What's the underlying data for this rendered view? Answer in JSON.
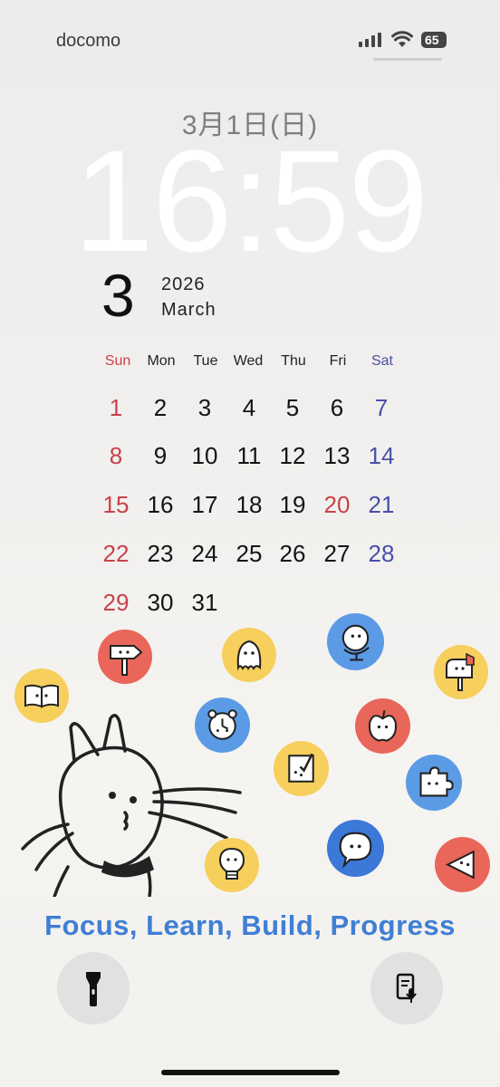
{
  "status_bar": {
    "carrier": "docomo",
    "battery": "65"
  },
  "lockscreen": {
    "date": "3月1日(日)",
    "time": "16:59"
  },
  "calendar": {
    "month_number": "3",
    "year": "2026",
    "month_name": "March",
    "weekdays": [
      "Sun",
      "Mon",
      "Tue",
      "Wed",
      "Thu",
      "Fri",
      "Sat"
    ],
    "weeks": [
      [
        "1",
        "2",
        "3",
        "4",
        "5",
        "6",
        "7"
      ],
      [
        "8",
        "9",
        "10",
        "11",
        "12",
        "13",
        "14"
      ],
      [
        "15",
        "16",
        "17",
        "18",
        "19",
        "20",
        "21"
      ],
      [
        "22",
        "23",
        "24",
        "25",
        "26",
        "27",
        "28"
      ],
      [
        "29",
        "30",
        "31",
        "",
        "",
        "",
        ""
      ]
    ],
    "holiday_red": [
      "20"
    ],
    "colors": {
      "sunday": "#c9424a",
      "saturday": "#4a50a8"
    }
  },
  "wallpaper": {
    "slogan": "Focus, Learn, Build, Progress",
    "icons": [
      "book-icon",
      "signpost-icon",
      "ghost-icon",
      "globe-icon",
      "mailbox-icon",
      "alarm-clock-icon",
      "apple-icon",
      "checklist-icon",
      "puzzle-icon",
      "lightbulb-icon",
      "speech-bubble-icon",
      "play-back-icon"
    ],
    "colors": {
      "red": "#e8675a",
      "yellow": "#f6cf5d",
      "blue": "#5b9be6",
      "slogan": "#3f7fd4"
    }
  },
  "quick_actions": {
    "left": "flashlight-icon",
    "right": "voice-memo-icon"
  }
}
